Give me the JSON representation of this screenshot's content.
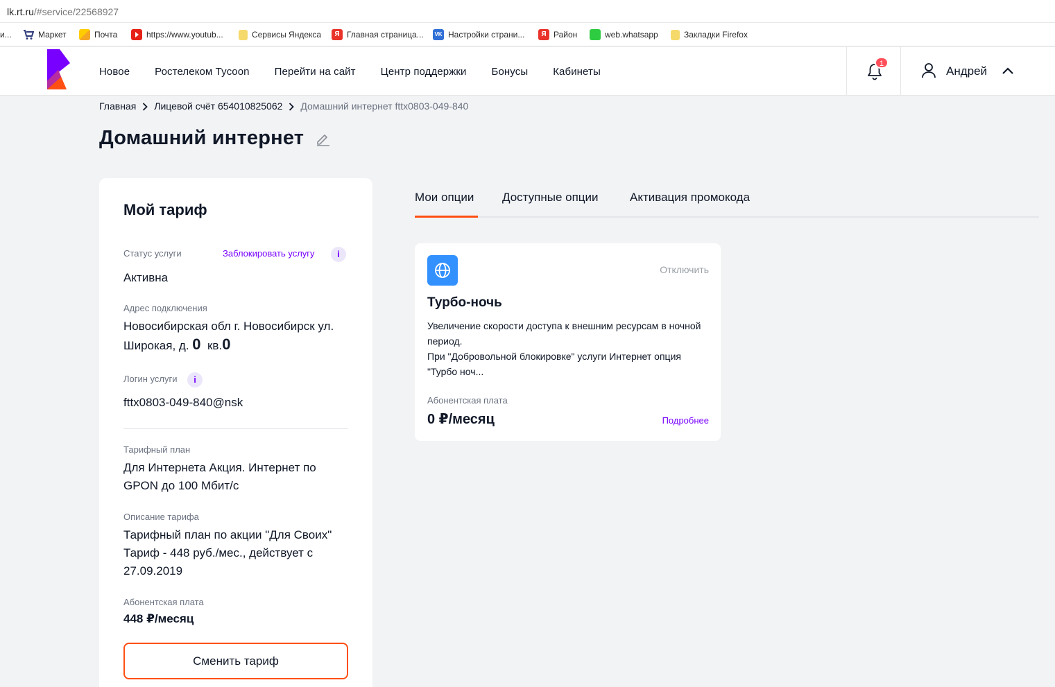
{
  "browser": {
    "url_host": "lk.rt.ru",
    "url_path": "/#service/22568927",
    "bookmarks": [
      {
        "label": "и...",
        "icon": "truncated"
      },
      {
        "label": "Маркет",
        "icon": "cart-icon"
      },
      {
        "label": "Почта",
        "icon": "mail-icon"
      },
      {
        "label": "https://www.youtub...",
        "icon": "youtube-icon"
      },
      {
        "label": "Сервисы Яндекса",
        "icon": "folder-icon"
      },
      {
        "label": "Главная страница...",
        "icon": "yandex-icon"
      },
      {
        "label": "Настройки страни...",
        "icon": "vk-icon"
      },
      {
        "label": "Район",
        "icon": "yandex-icon"
      },
      {
        "label": "web.whatsapp",
        "icon": "whatsapp-icon"
      },
      {
        "label": "Закладки Firefox",
        "icon": "folder-icon"
      }
    ]
  },
  "header": {
    "nav": [
      "Новое",
      "Ростелеком Tycoon",
      "Перейти на сайт",
      "Центр поддержки",
      "Бонусы",
      "Кабинеты"
    ],
    "notifications_count": "1",
    "user_name": "Андрей"
  },
  "breadcrumb": {
    "home": "Главная",
    "account": "Лицевой счёт 654010825062",
    "current": "Домашний интернет fttx0803-049-840"
  },
  "page": {
    "title": "Домашний интернет"
  },
  "tariff": {
    "title": "Мой тариф",
    "status_label": "Статус услуги",
    "block_link": "Заблокировать услугу",
    "status_value": "Активна",
    "address_label": "Адрес подключения",
    "address_line1": "Новосибирская обл г. Новосибирск ул.",
    "address_line2_prefix": "Широкая, д.",
    "address_house": "0",
    "address_flat_prefix": "кв.",
    "address_flat": "0",
    "login_label": "Логин услуги",
    "login_value": "fttx0803-049-840@nsk",
    "plan_label": "Тарифный план",
    "plan_value": "Для Интернета Акция. Интернет по GPON до 100 Мбит/с",
    "desc_label": "Описание тарифа",
    "desc_value": "Тарифный план по акции \"Для Своих\" Тариф - 448 руб./мес., действует с 27.09.2019",
    "fee_label": "Абонентская плата",
    "fee_value": "448 ₽/месяц",
    "change_button": "Сменить тариф"
  },
  "tabs": [
    "Мои опции",
    "Доступные опции",
    "Активация промокода"
  ],
  "option": {
    "icon": "globe-icon",
    "disable_label": "Отключить",
    "name": "Турбо-ночь",
    "desc_line1": "Увеличение скорости доступа к внешним ресурсам в ночной период.",
    "desc_line2": "При \"Добровольной блокировке\" услуги Интернет опция \"Турбо ноч...",
    "fee_label": "Абонентская плата",
    "fee_value": "0 ₽/месяц",
    "more_link": "Подробнее"
  },
  "colors": {
    "accent": "#ff4f12",
    "brand_purple": "#7700ff",
    "option_icon_bg": "#3391ff",
    "badge": "#ff4f5a"
  }
}
